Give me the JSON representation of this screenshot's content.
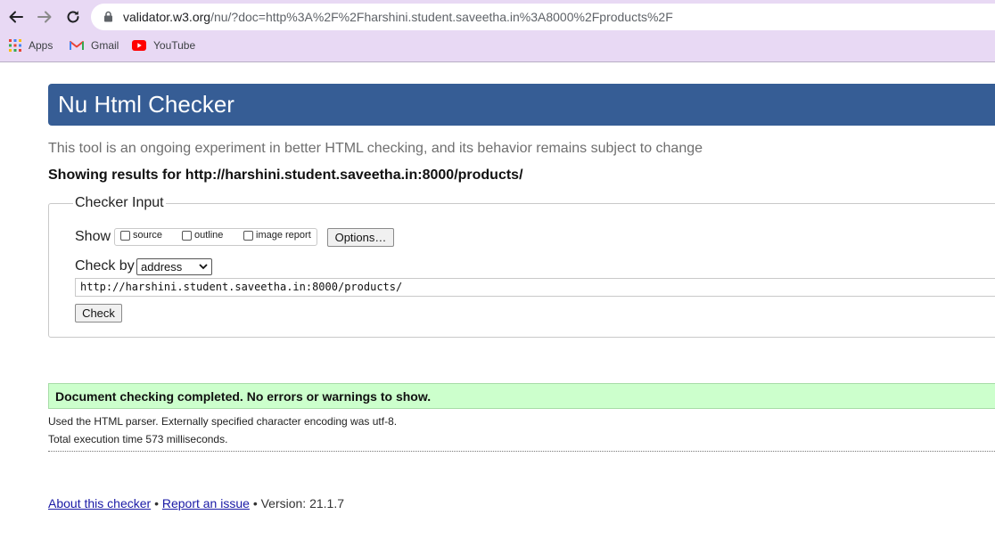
{
  "browser": {
    "url_host": "validator.w3.org",
    "url_path": "/nu/?doc=http%3A%2F%2Fharshini.student.saveetha.in%3A8000%2Fproducts%2F",
    "bookmarks": [
      {
        "label": "Apps",
        "icon": "apps-grid-icon"
      },
      {
        "label": "Gmail",
        "icon": "gmail-icon"
      },
      {
        "label": "YouTube",
        "icon": "youtube-icon"
      }
    ],
    "colors": {
      "chrome": "#e8d9f4"
    }
  },
  "page": {
    "title": "Nu Html Checker",
    "tagline": "This tool is an ongoing experiment in better HTML checking, and its behavior remains subject to change",
    "showing_results": "Showing results for http://harshini.student.saveetha.in:8000/products/",
    "colors": {
      "banner": "#365d95",
      "success": "#ccffcc",
      "link": "#1a1aa6"
    }
  },
  "checker_input": {
    "legend": "Checker Input",
    "show_label": "Show",
    "show_options": [
      {
        "label": "source",
        "checked": false
      },
      {
        "label": "outline",
        "checked": false
      },
      {
        "label": "image report",
        "checked": false
      }
    ],
    "options_button": "Options…",
    "check_by_label": "Check by",
    "check_by_selected": "address",
    "url_value": "http://harshini.student.saveetha.in:8000/products/",
    "check_button": "Check"
  },
  "results": {
    "message": "Document checking completed. No errors or warnings to show.",
    "parser_info": "Used the HTML parser. Externally specified character encoding was utf-8.",
    "execution_time": "Total execution time 573 milliseconds."
  },
  "footer": {
    "about_link": "About this checker",
    "separator": "•",
    "report_link": "Report an issue",
    "version": "Version: 21.1.7"
  }
}
